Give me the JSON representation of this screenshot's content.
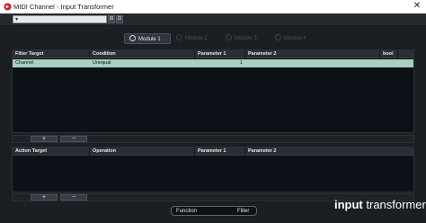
{
  "window": {
    "title": "MIDI Channel - Input Transformer",
    "close_glyph": "✕"
  },
  "toolbar": {
    "preset_value": "",
    "preset_arrow": "▾",
    "btn1": "⊞",
    "btn2": "⊟"
  },
  "tabs": [
    {
      "label": "Module 1",
      "active": true
    },
    {
      "label": "Module 2",
      "active": false
    },
    {
      "label": "Module 3",
      "active": false
    },
    {
      "label": "Module 4",
      "active": false
    }
  ],
  "filter_table": {
    "columns": [
      "Filter Target",
      "Condition",
      "Parameter 1",
      "Parameter 2",
      "bool"
    ],
    "rows": [
      {
        "target": "Channel",
        "condition": "Unequal",
        "param1": "1",
        "param2": "",
        "bool": ""
      }
    ]
  },
  "action_table": {
    "columns": [
      "Action Target",
      "Operation",
      "Parameter 1",
      "Parameter 2"
    ],
    "rows": []
  },
  "buttons": {
    "add": "+",
    "remove": "−"
  },
  "function": {
    "label": "Function",
    "value": "Filter"
  },
  "logo": {
    "bold": "input",
    "light": "transformer"
  }
}
